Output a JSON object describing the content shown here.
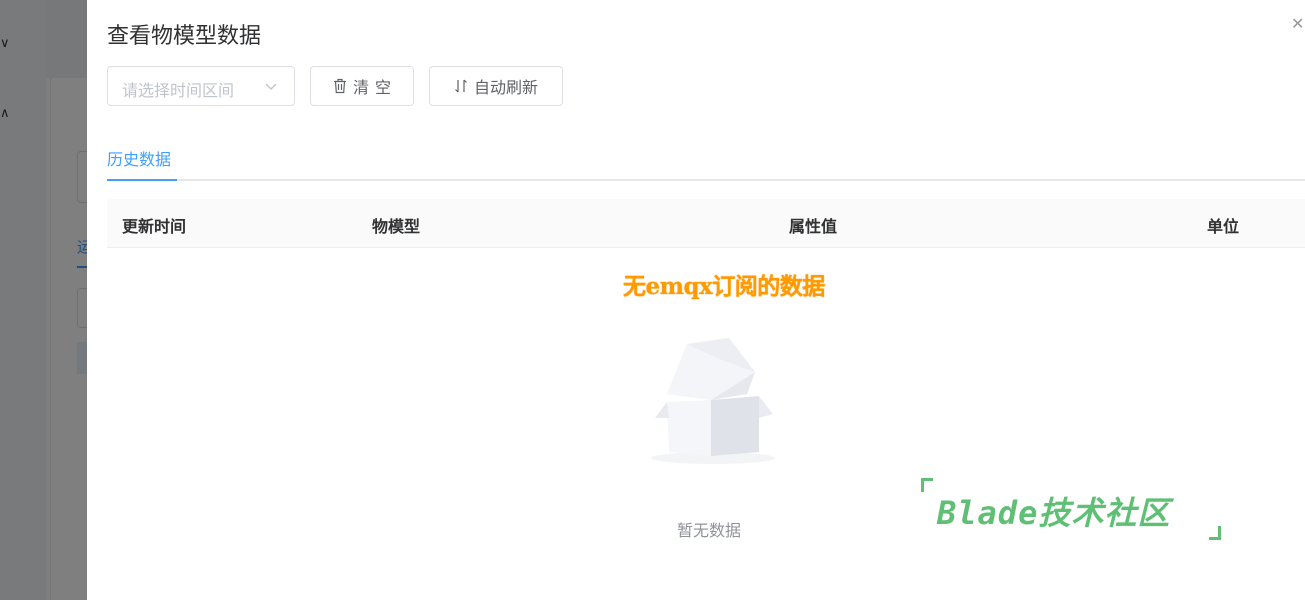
{
  "drawer": {
    "title": "查看物模型数据",
    "close_icon": "close-icon"
  },
  "toolbar": {
    "time_select_placeholder": "请选择时间区间",
    "clear_label": "清空",
    "clear_icon": "trash-icon",
    "refresh_label": "自动刷新",
    "refresh_icon": "sort-arrows-icon"
  },
  "tabs": [
    {
      "label": "历史数据",
      "active": true
    }
  ],
  "table": {
    "columns": [
      "更新时间",
      "物模型",
      "属性值",
      "单位"
    ],
    "rows": [],
    "empty_text": "暂无数据"
  },
  "banner": "无emqx订阅的数据",
  "watermark": "Blade技术社区",
  "background": {
    "tab_label_partial": "运"
  },
  "colors": {
    "accent": "#409eff",
    "banner": "#ff9a00",
    "watermark": "#5fbf74"
  }
}
